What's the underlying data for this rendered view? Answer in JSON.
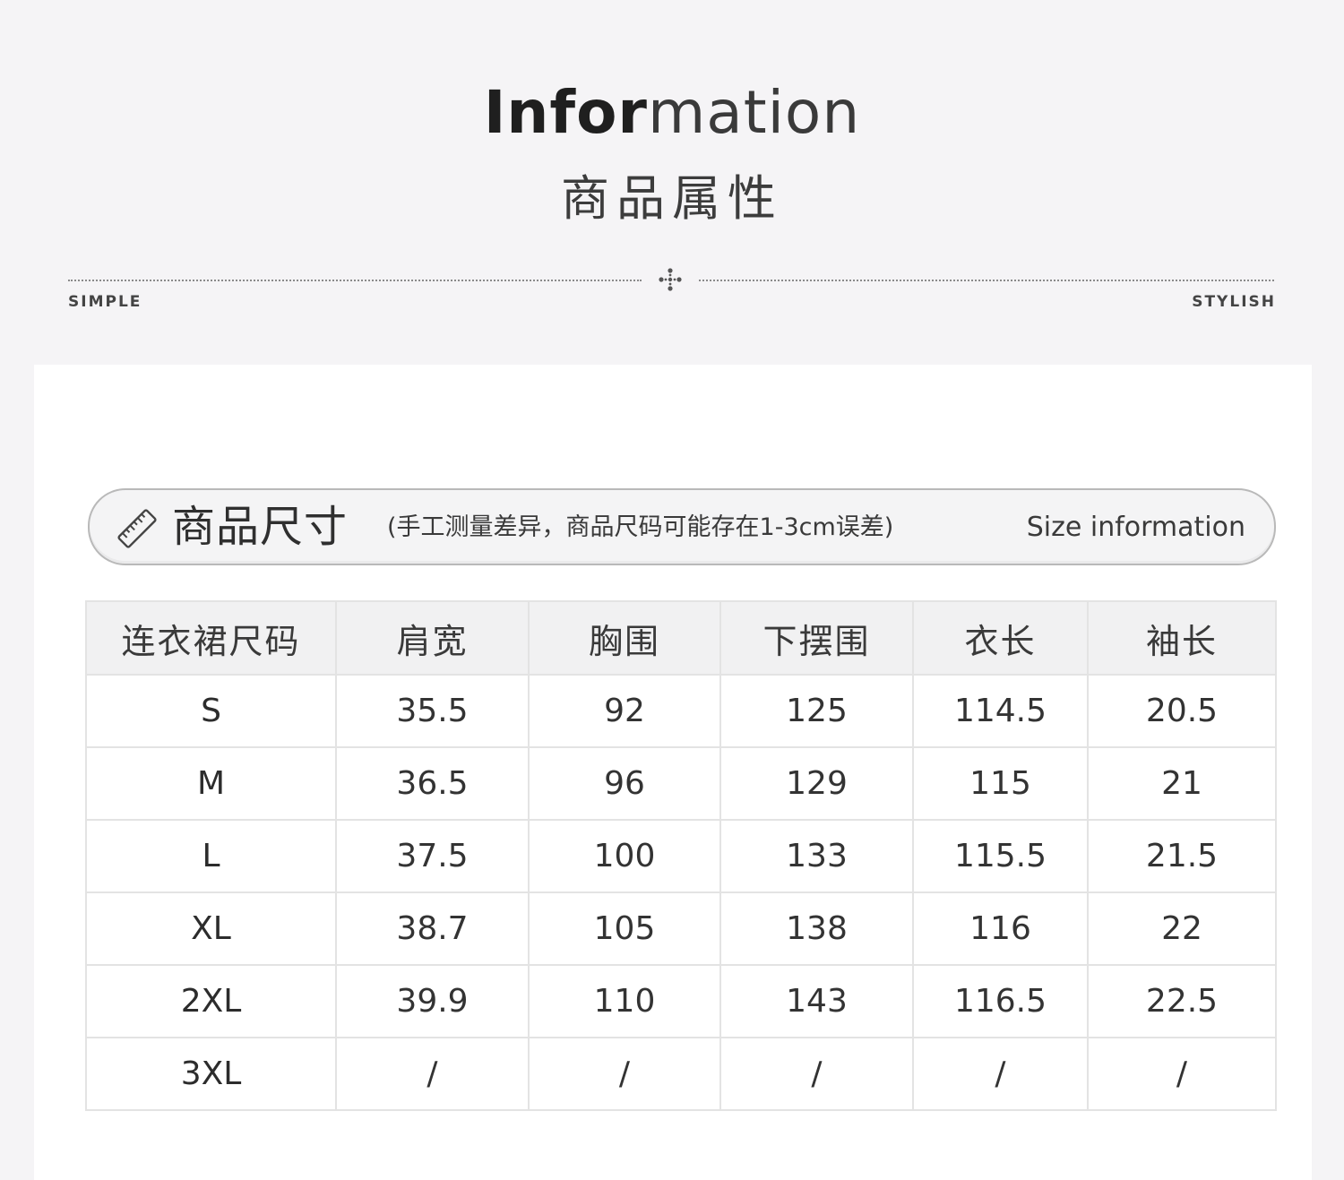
{
  "header": {
    "title_en_bold": "Infor",
    "title_en_light": "mation",
    "title_cn": "商品属性",
    "left_word": "SIMPLE",
    "right_word": "STYLISH",
    "divider_icon": "four-dot-diamond-icon"
  },
  "banner": {
    "icon": "ruler-icon",
    "title": "商品尺寸",
    "note": "(手工测量差异，商品尺码可能存在1-3cm误差)",
    "title_en": "Size information"
  },
  "table": {
    "headers": [
      "连衣裙尺码",
      "肩宽",
      "胸围",
      "下摆围",
      "衣长",
      "袖长"
    ],
    "rows": [
      [
        "S",
        "35.5",
        "92",
        "125",
        "114.5",
        "20.5"
      ],
      [
        "M",
        "36.5",
        "96",
        "129",
        "115",
        "21"
      ],
      [
        "L",
        "37.5",
        "100",
        "133",
        "115.5",
        "21.5"
      ],
      [
        "XL",
        "38.7",
        "105",
        "138",
        "116",
        "22"
      ],
      [
        "2XL",
        "39.9",
        "110",
        "143",
        "116.5",
        "22.5"
      ],
      [
        "3XL",
        "/",
        "/",
        "/",
        "/",
        "/"
      ]
    ]
  },
  "colors": {
    "page_background": "#f5f4f6",
    "panel_background": "#ffffff",
    "header_cell_background": "#f1f1f2",
    "border": "#e3e3e3",
    "text": "#333333"
  }
}
